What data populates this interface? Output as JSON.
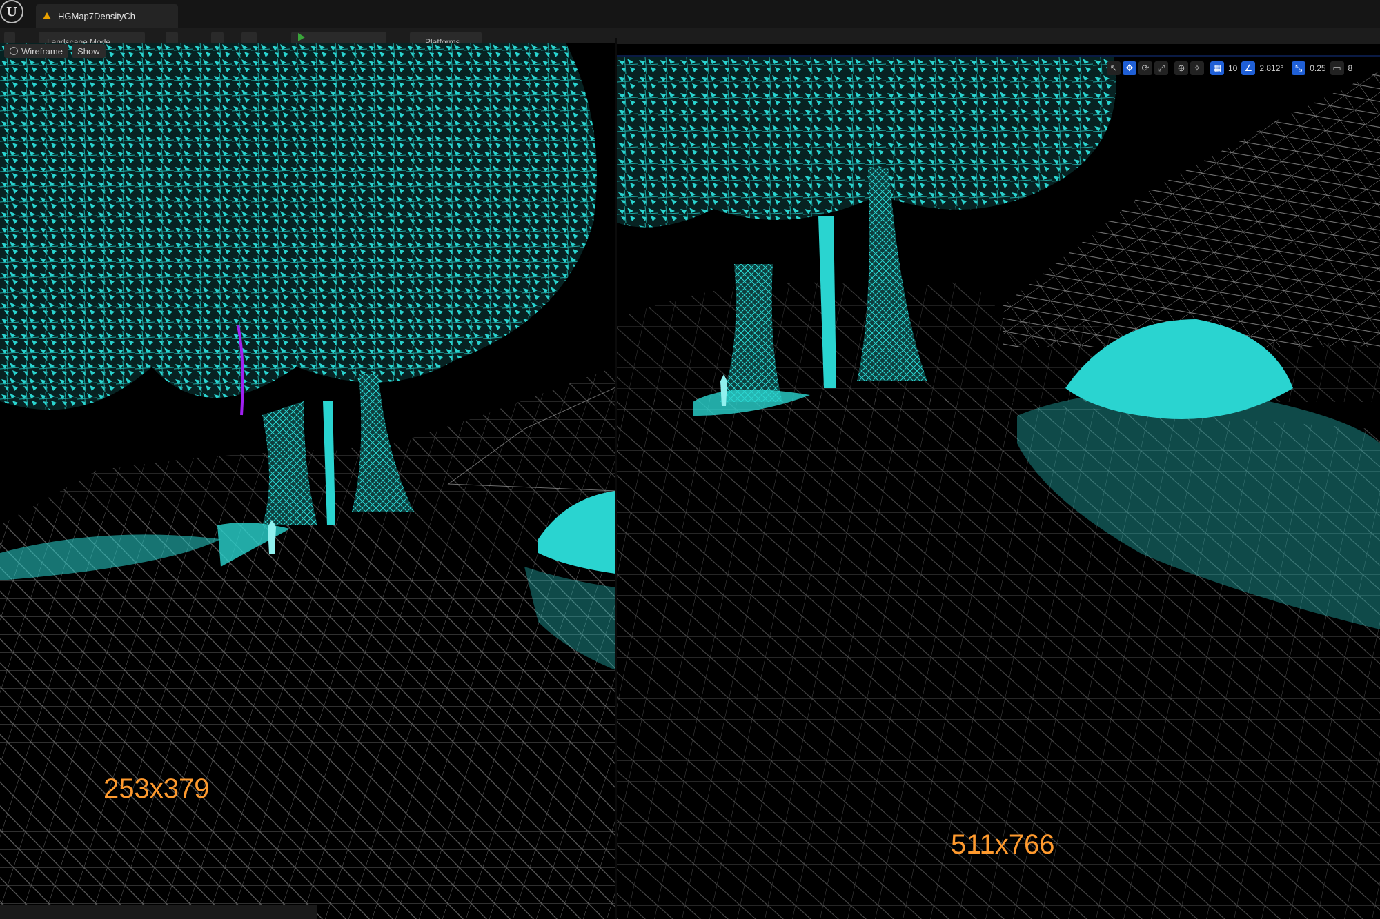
{
  "window": {
    "tab_title": "HGMap7DensityCh",
    "mode_label": "Landscape Mode",
    "platforms_label": "Platforms"
  },
  "viewport_left": {
    "view_mode": "Wireframe",
    "show": "Show",
    "resolution_label": "253x379"
  },
  "viewport_right": {
    "resolution_label": "511x766",
    "toolbar": {
      "grid_snap": "10",
      "rotation_snap": "2.812°",
      "scale_snap": "0.25",
      "camera_speed": "8"
    }
  },
  "colors": {
    "foliage": "#2ad4d0",
    "mesh": "#c8c8c8",
    "label": "#ff9a2e",
    "accent": "#1f5fd6"
  },
  "icons": [
    "unreal-logo-icon",
    "warning-icon",
    "play-icon",
    "select-icon",
    "translate-icon",
    "rotate-icon",
    "scale-icon",
    "world-icon",
    "surface-snap-icon",
    "grid-icon",
    "angle-icon",
    "scale-snap-icon",
    "camera-icon"
  ]
}
